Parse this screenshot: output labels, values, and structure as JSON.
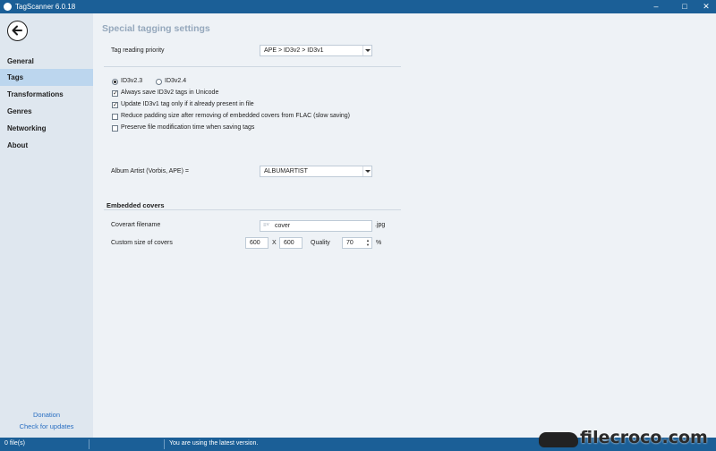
{
  "window": {
    "title": "TagScanner 6.0.18",
    "minimize_icon": "minimize-icon",
    "maximize_icon": "maximize-icon",
    "close_icon": "close-icon"
  },
  "sidebar": {
    "back_icon": "arrow-left-icon",
    "items": [
      {
        "label": "General",
        "active": false
      },
      {
        "label": "Tags",
        "active": true
      },
      {
        "label": "Transformations",
        "active": false
      },
      {
        "label": "Genres",
        "active": false
      },
      {
        "label": "Networking",
        "active": false
      },
      {
        "label": "About",
        "active": false
      }
    ],
    "donation_label": "Donation",
    "check_updates_label": "Check for updates"
  },
  "main": {
    "section_title": "Special tagging settings",
    "reading_priority": {
      "label": "Tag reading priority",
      "value": "APE > ID3v2 > ID3v1"
    },
    "id3_version": {
      "options": [
        {
          "label": "ID3v2.3",
          "selected": true
        },
        {
          "label": "ID3v2.4",
          "selected": false
        }
      ]
    },
    "checkboxes": [
      {
        "label": "Always save ID3v2 tags in Unicode",
        "checked": true
      },
      {
        "label": "Update ID3v1 tag only if it already present in file",
        "checked": true
      },
      {
        "label": "Reduce padding size after removing of embedded covers from FLAC (slow saving)",
        "checked": false
      },
      {
        "label": "Preserve file modification time when saving tags",
        "checked": false
      }
    ],
    "album_artist": {
      "label": "Album Artist (Vorbis, APE) =",
      "value": "ALBUMARTIST"
    },
    "embedded_covers": {
      "title": "Embedded covers",
      "filename_label": "Coverart filename",
      "filename_value": "cover",
      "filename_ext": ".jpg",
      "size_label": "Custom size of covers",
      "width": "600",
      "x_sep": "X",
      "height": "600",
      "quality_label": "Quality",
      "quality_value": "70",
      "percent": "%"
    }
  },
  "statusbar": {
    "files": "0 file(s)",
    "message": "You are using the latest version."
  },
  "watermark": {
    "text": "filecroco.com"
  },
  "colors": {
    "titlebar": "#1b5f97",
    "sidebar_bg": "#dfe7ef",
    "sidebar_active": "#bcd6ee",
    "main_bg": "#eef2f6",
    "section_title": "#95a8bc",
    "link": "#2a6fc2"
  }
}
